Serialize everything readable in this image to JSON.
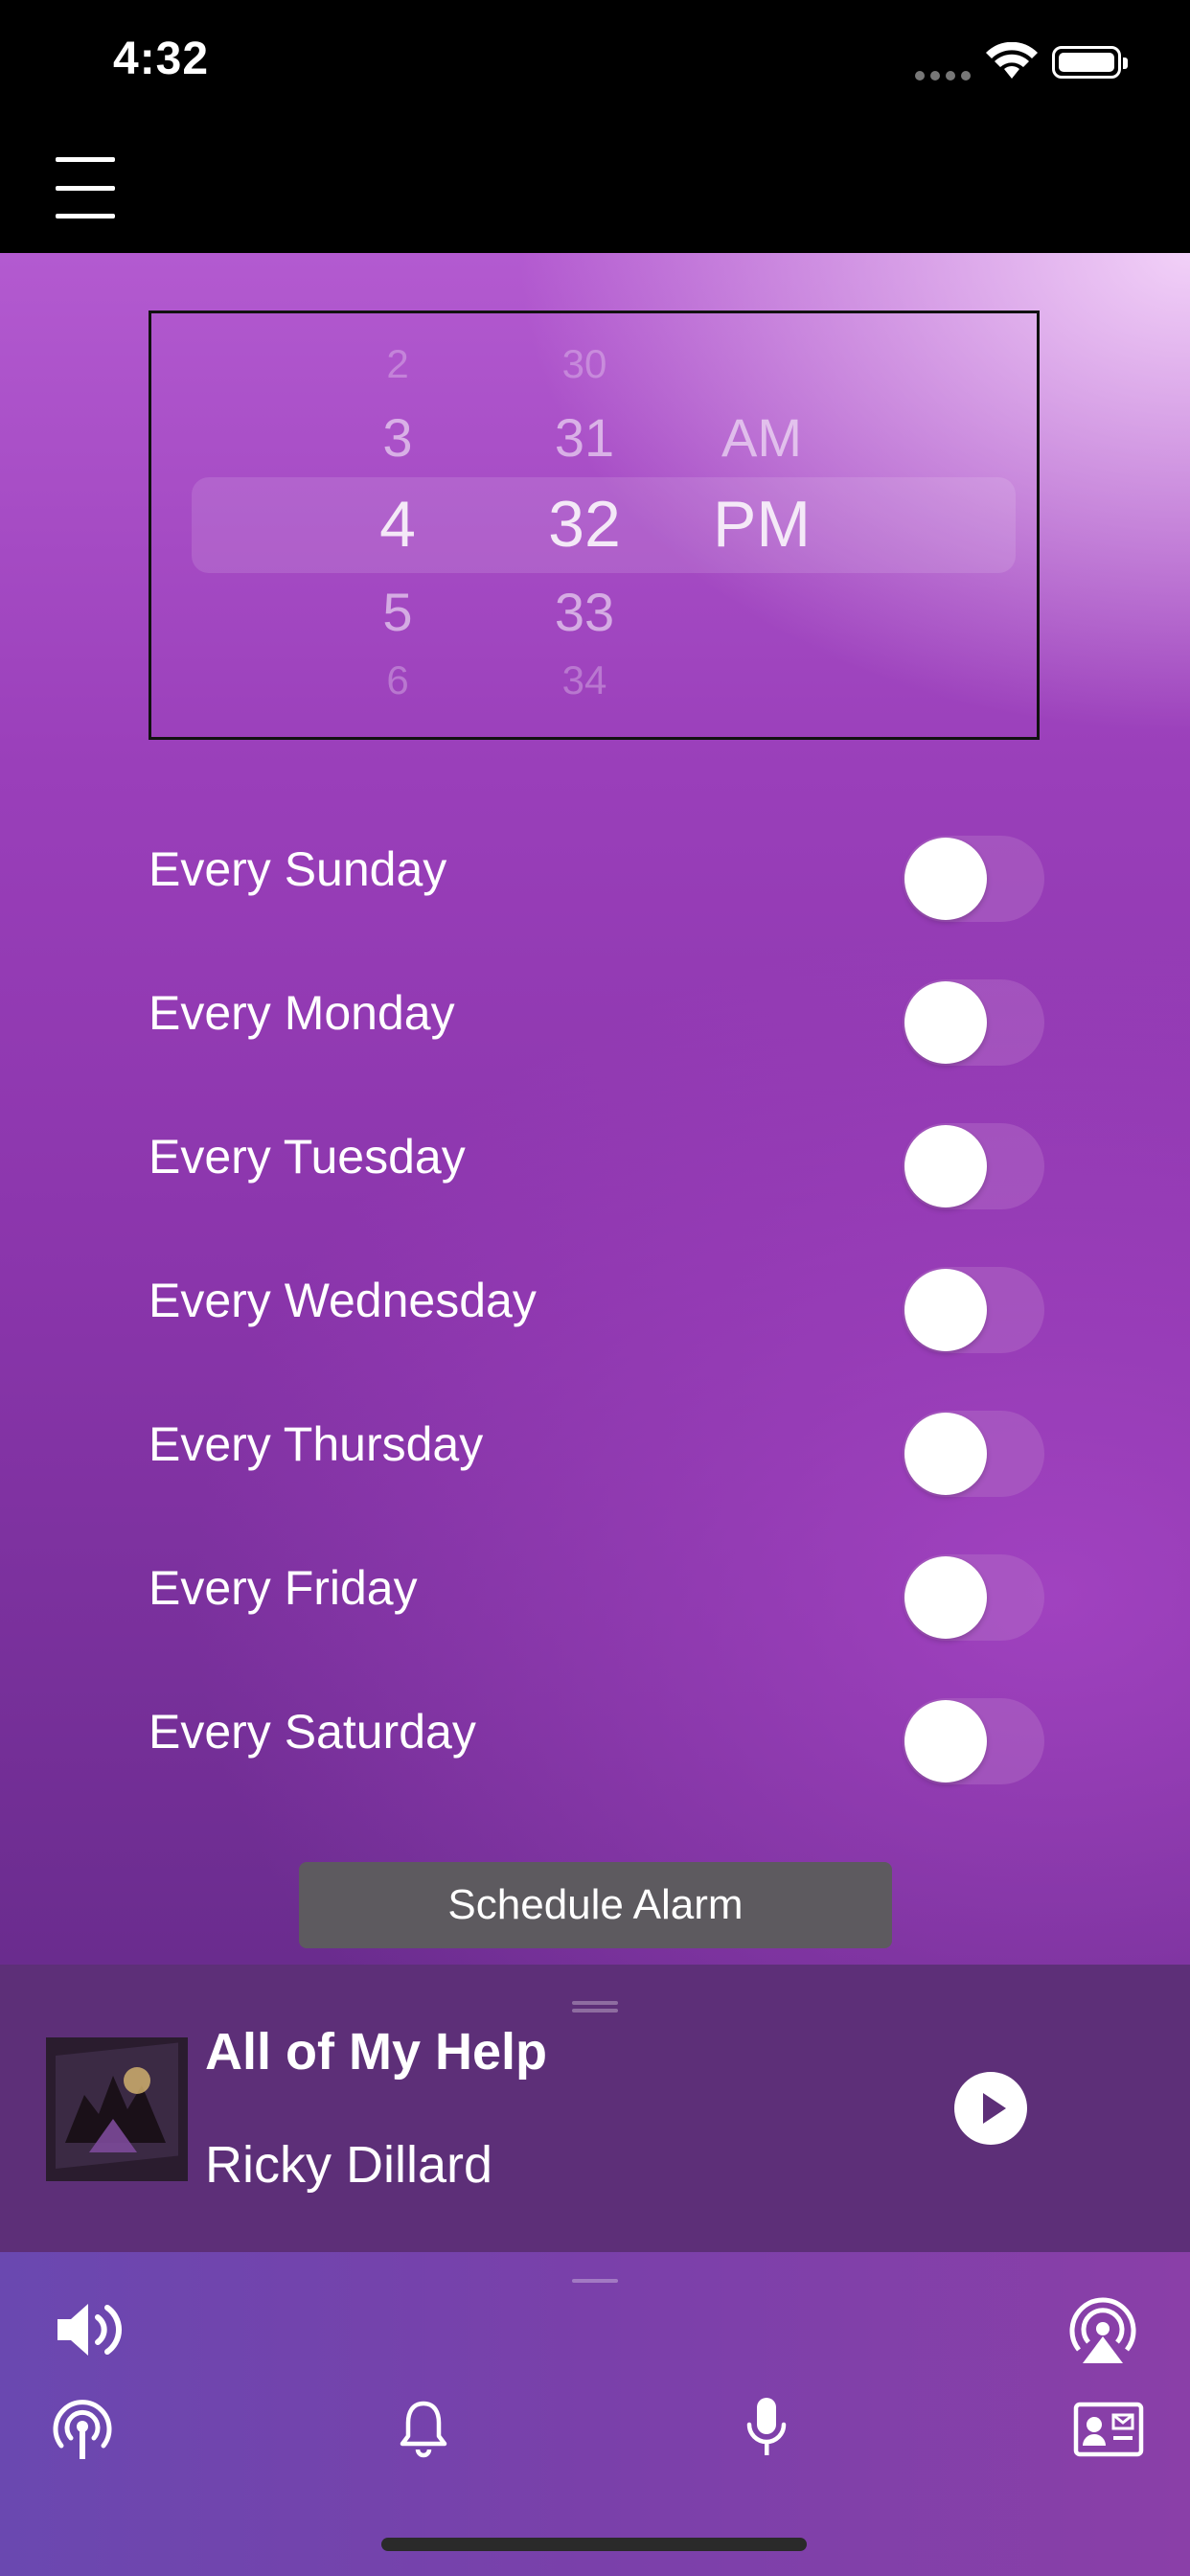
{
  "status_bar": {
    "time": "4:32"
  },
  "picker": {
    "hours": [
      "2",
      "3",
      "4",
      "5",
      "6"
    ],
    "minutes": [
      "30",
      "31",
      "32",
      "33",
      "34"
    ],
    "periods": [
      "AM",
      "PM"
    ]
  },
  "days": [
    {
      "label": "Every Sunday",
      "on": false
    },
    {
      "label": "Every Monday",
      "on": false
    },
    {
      "label": "Every Tuesday",
      "on": false
    },
    {
      "label": "Every Wednesday",
      "on": false
    },
    {
      "label": "Every Thursday",
      "on": false
    },
    {
      "label": "Every Friday",
      "on": false
    },
    {
      "label": "Every Saturday",
      "on": false
    }
  ],
  "schedule_button": "Schedule Alarm",
  "player": {
    "title": "All of My Help",
    "artist": "Ricky Dillard",
    "state": "paused"
  },
  "icons": {
    "menu": "hamburger-menu-icon",
    "volume": "speaker-icon",
    "airplay": "airplay-icon",
    "radio": "broadcast-icon",
    "alarm": "bell-icon",
    "mic": "microphone-icon",
    "contact": "contact-card-icon"
  },
  "colors": {
    "accent": "#9a3fba",
    "player_bg": "#5d2f78",
    "button_bg": "#5d5a5f"
  }
}
